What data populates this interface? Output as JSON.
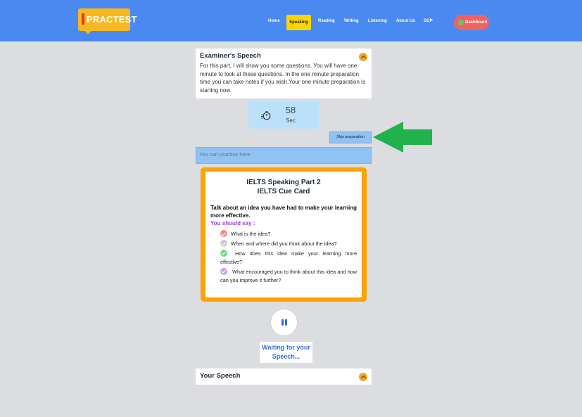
{
  "header": {
    "logo_text": "PRACTEST",
    "nav": [
      {
        "label": "Home",
        "active": false
      },
      {
        "label": "Speaking",
        "active": true
      },
      {
        "label": "Reading",
        "active": false
      },
      {
        "label": "Writing",
        "active": false
      },
      {
        "label": "Listening",
        "active": false
      },
      {
        "label": "About Us",
        "active": false
      },
      {
        "label": "SOP",
        "active": false
      }
    ],
    "dashboard_label": "Dashboard"
  },
  "examiner": {
    "title": "Examiner's Speech",
    "text": "For this part, I will show you some questions. You will have one minute to look at these questions. In the one minute preparation time you can take notes if you wish.Your one minute preparation is starting now."
  },
  "timer": {
    "value": "58",
    "unit": "Sec",
    "icon": "stopwatch-icon"
  },
  "skip_button": "Skip preparation",
  "practice": {
    "placeholder": "You can practice here"
  },
  "cue_card": {
    "title_line1": "IELTS Speaking Part 2",
    "title_line2": "IELTS Cue Card",
    "task": "Talk about an idea you have had to make your learning more effective.",
    "should_say": "You should say :",
    "items": [
      {
        "text": "What is the idea?",
        "color": "#f28b82"
      },
      {
        "text": "When and where did you think about the idea?",
        "color": "#c7cbd1"
      },
      {
        "text": "How does this idea make your learning more effective?",
        "color": "#6fd889"
      },
      {
        "text": "What encouraged you to think about this idea and how can you improve it further?",
        "color": "#c9a3ee"
      }
    ]
  },
  "recorder": {
    "state_icon": "pause-icon",
    "status": "Waiting for your Speech..."
  },
  "your_speech": {
    "title": "Your Speech"
  },
  "colors": {
    "navbar": "#4a8af0",
    "accent_orange": "#ffa200",
    "active_nav": "#ffd600",
    "dashboard": "#f06161",
    "arrow": "#22b24c"
  }
}
